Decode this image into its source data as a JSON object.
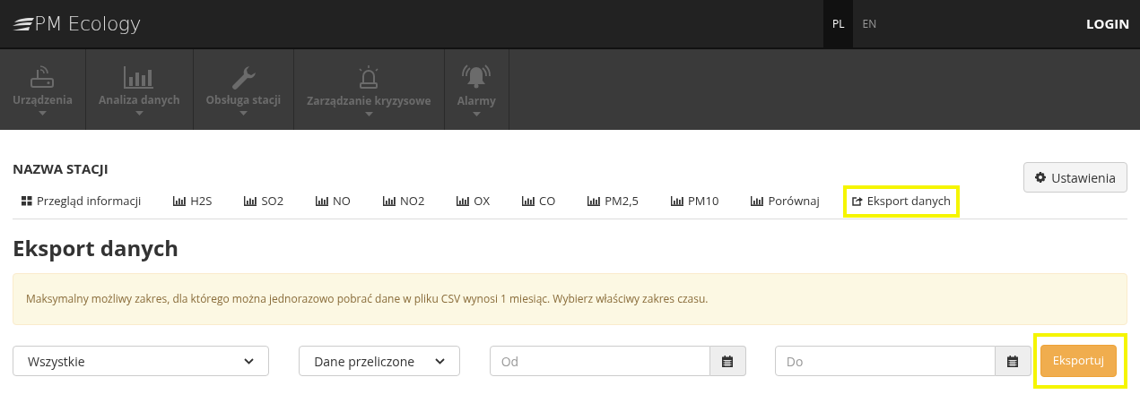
{
  "header": {
    "brand": "PM Ecology",
    "languages": [
      {
        "label": "PL",
        "selected": true
      },
      {
        "label": "EN",
        "selected": false
      }
    ],
    "login": "LOGIN"
  },
  "nav": [
    {
      "label": "Urządzenia",
      "kind": "router"
    },
    {
      "label": "Analiza danych",
      "kind": "chart"
    },
    {
      "label": "Obsługa stacji",
      "kind": "wrench"
    },
    {
      "label": "Zarządzanie kryzysowe",
      "kind": "beacon"
    },
    {
      "label": "Alarmy",
      "kind": "bell"
    }
  ],
  "station": {
    "name": "NAZWA STACJI",
    "settings_button": "Ustawienia"
  },
  "tabs": [
    {
      "label": "Przegląd informacji",
      "kind": "overview",
      "highlighted": false
    },
    {
      "label": "H2S",
      "kind": "chart",
      "highlighted": false
    },
    {
      "label": "SO2",
      "kind": "chart",
      "highlighted": false
    },
    {
      "label": "NO",
      "kind": "chart",
      "highlighted": false
    },
    {
      "label": "NO2",
      "kind": "chart",
      "highlighted": false
    },
    {
      "label": "OX",
      "kind": "chart",
      "highlighted": false
    },
    {
      "label": "CO",
      "kind": "chart",
      "highlighted": false
    },
    {
      "label": "PM2,5",
      "kind": "chart",
      "highlighted": false
    },
    {
      "label": "PM10",
      "kind": "chart",
      "highlighted": false
    },
    {
      "label": "Porównaj",
      "kind": "chart",
      "highlighted": false
    },
    {
      "label": "Eksport danych",
      "kind": "export",
      "highlighted": true
    }
  ],
  "page_title": "Eksport danych",
  "alert": "Maksymalny możliwy zakres, dla którego można jednorazowo pobrać dane w pliku CSV wynosi 1 miesiąc. Wybierz właściwy zakres czasu.",
  "form": {
    "sensor_select": "Wszystkie",
    "data_select": "Dane przeliczone",
    "from": {
      "placeholder": "Od"
    },
    "to": {
      "placeholder": "Do"
    },
    "export_button": {
      "label": "Eksportuj",
      "highlighted": true
    }
  }
}
